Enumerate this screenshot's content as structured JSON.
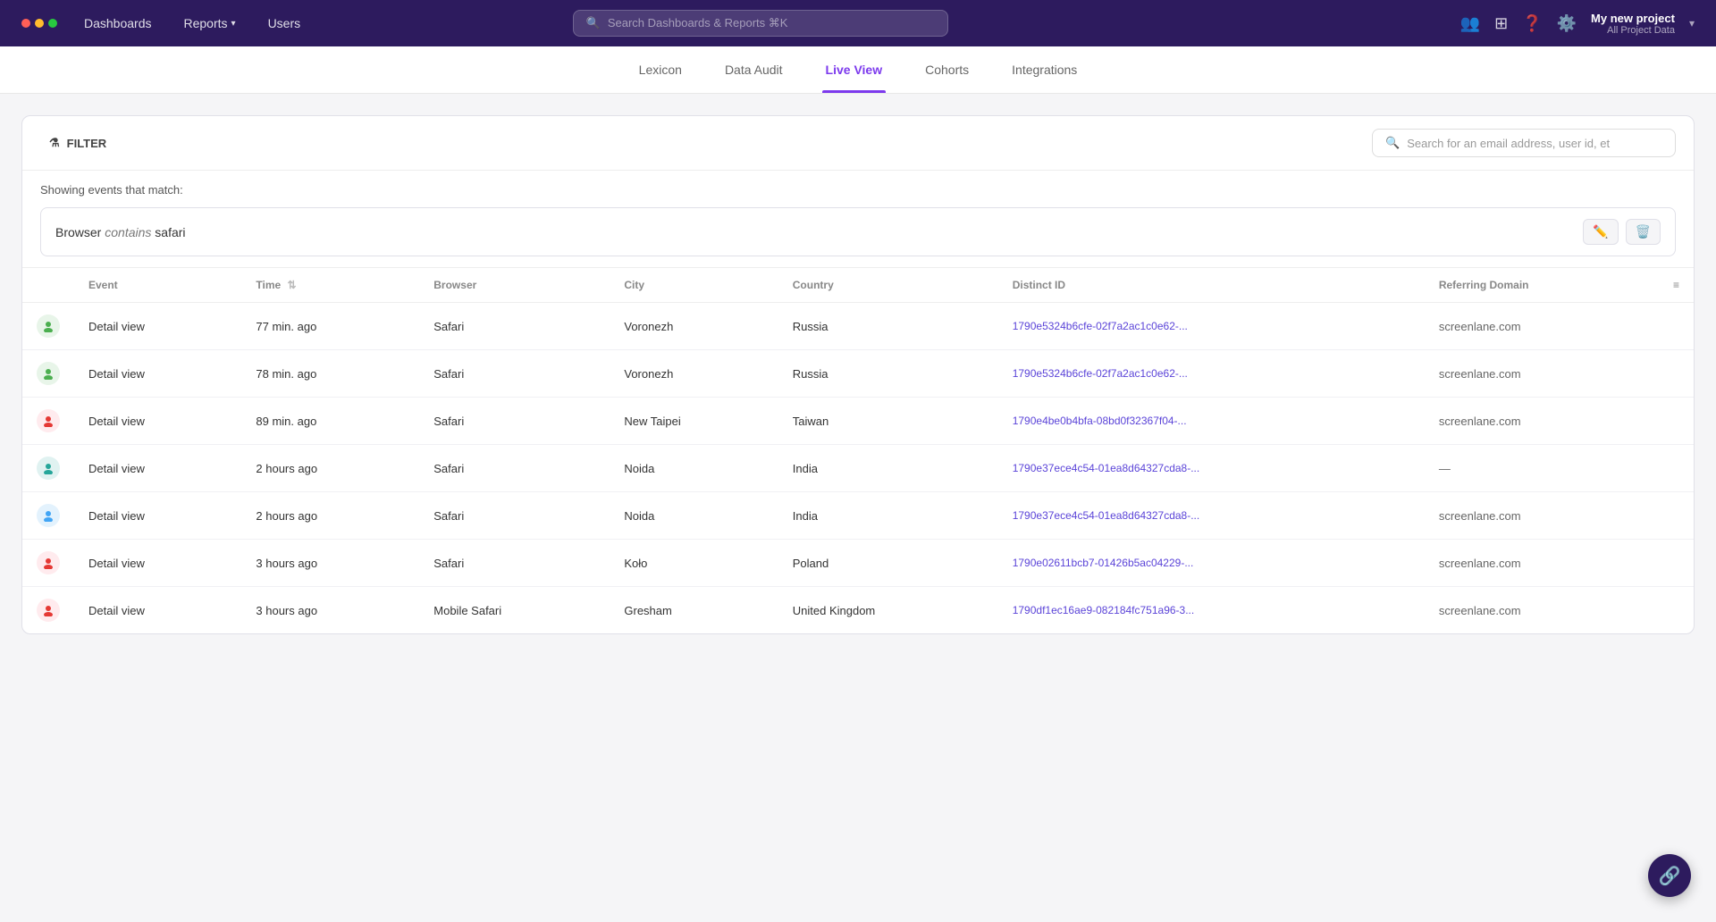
{
  "nav": {
    "dots": [
      {
        "color": "red"
      },
      {
        "color": "yellow"
      },
      {
        "color": "green"
      }
    ],
    "items": [
      {
        "label": "Dashboards",
        "active": false
      },
      {
        "label": "Reports",
        "active": false,
        "hasChevron": true
      },
      {
        "label": "Users",
        "active": false
      }
    ],
    "search_placeholder": "Search Dashboards & Reports ⌘K",
    "icons": [
      "grid-4",
      "apps",
      "help",
      "settings"
    ],
    "project": {
      "name": "My new project",
      "sub": "All Project Data"
    }
  },
  "sub_nav": {
    "items": [
      {
        "label": "Lexicon",
        "active": false
      },
      {
        "label": "Data Audit",
        "active": false
      },
      {
        "label": "Live View",
        "active": true
      },
      {
        "label": "Cohorts",
        "active": false
      },
      {
        "label": "Integrations",
        "active": false
      }
    ]
  },
  "filter": {
    "label": "FILTER",
    "search_placeholder": "Search for an email address, user id, et"
  },
  "showing_label": "Showing events that match:",
  "condition": {
    "field": "Browser",
    "operator": "contains",
    "value": "safari"
  },
  "table": {
    "columns": [
      {
        "label": "Event",
        "sortable": false
      },
      {
        "label": "Time",
        "sortable": true
      },
      {
        "label": "Browser",
        "sortable": false
      },
      {
        "label": "City",
        "sortable": false
      },
      {
        "label": "Country",
        "sortable": false
      },
      {
        "label": "Distinct ID",
        "sortable": false
      },
      {
        "label": "Referring Domain",
        "sortable": false
      }
    ],
    "rows": [
      {
        "avatar_color": "#4caf50",
        "avatar_bg": "#e8f5e9",
        "event": "Detail view",
        "time": "77 min. ago",
        "browser": "Safari",
        "city": "Voronezh",
        "country": "Russia",
        "distinct_id": "1790e5324b6cfe-02f7a2ac1c0e62-...",
        "referring_domain": "screenlane.com"
      },
      {
        "avatar_color": "#4caf50",
        "avatar_bg": "#e8f5e9",
        "event": "Detail view",
        "time": "78 min. ago",
        "browser": "Safari",
        "city": "Voronezh",
        "country": "Russia",
        "distinct_id": "1790e5324b6cfe-02f7a2ac1c0e62-...",
        "referring_domain": "screenlane.com"
      },
      {
        "avatar_color": "#e53935",
        "avatar_bg": "#ffebee",
        "event": "Detail view",
        "time": "89 min. ago",
        "browser": "Safari",
        "city": "New Taipei",
        "country": "Taiwan",
        "distinct_id": "1790e4be0b4bfa-08bd0f32367f04-...",
        "referring_domain": "screenlane.com"
      },
      {
        "avatar_color": "#26a69a",
        "avatar_bg": "#e0f2f1",
        "event": "Detail view",
        "time": "2 hours ago",
        "browser": "Safari",
        "city": "Noida",
        "country": "India",
        "distinct_id": "1790e37ece4c54-01ea8d64327cda8-...",
        "referring_domain": "—"
      },
      {
        "avatar_color": "#42a5f5",
        "avatar_bg": "#e3f2fd",
        "event": "Detail view",
        "time": "2 hours ago",
        "browser": "Safari",
        "city": "Noida",
        "country": "India",
        "distinct_id": "1790e37ece4c54-01ea8d64327cda8-...",
        "referring_domain": "screenlane.com"
      },
      {
        "avatar_color": "#e53935",
        "avatar_bg": "#ffebee",
        "event": "Detail view",
        "time": "3 hours ago",
        "browser": "Safari",
        "city": "Koło",
        "country": "Poland",
        "distinct_id": "1790e02611bcb7-01426b5ac04229-...",
        "referring_domain": "screenlane.com"
      },
      {
        "avatar_color": "#e53935",
        "avatar_bg": "#ffebee",
        "event": "Detail view",
        "time": "3 hours ago",
        "browser": "Mobile Safari",
        "city": "Gresham",
        "country": "United Kingdom",
        "distinct_id": "1790df1ec16ae9-082184fc751a96-3...",
        "referring_domain": "screenlane.com"
      }
    ]
  },
  "float_btn": {
    "icon": "🔗"
  }
}
